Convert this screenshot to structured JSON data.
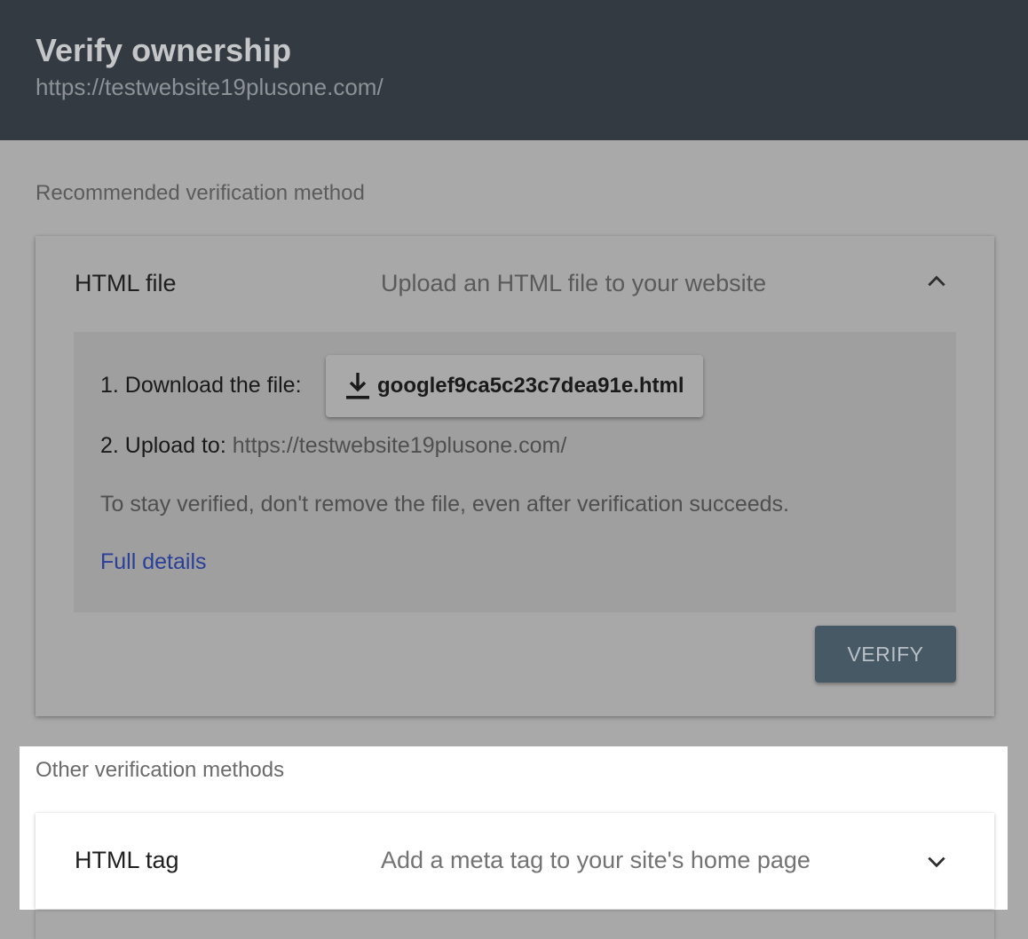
{
  "header": {
    "title": "Verify ownership",
    "url": "https://testwebsite19plusone.com/"
  },
  "recommended": {
    "section_label": "Recommended verification method",
    "method_name": "HTML file",
    "method_desc": "Upload an HTML file to your website",
    "expanded": true,
    "step1_label": "1. Download the file:",
    "download_file": "googlef9ca5c23c7dea91e.html",
    "step2_label": "2. Upload to:",
    "step2_url": "https://testwebsite19plusone.com/",
    "note": "To stay verified, don't remove the file, even after verification succeeds.",
    "link": "Full details",
    "verify_label": "VERIFY"
  },
  "other": {
    "section_label": "Other verification methods",
    "methods": [
      {
        "name": "HTML tag",
        "desc": "Add a meta tag to your site's home page",
        "expanded": false
      }
    ]
  },
  "colors": {
    "header_bg": "#333a41",
    "verify_button_bg": "#485966",
    "link": "#2a3f9a",
    "overlay_bg": "#a9a9a9"
  },
  "icons": {
    "download": "download-icon",
    "collapse": "chevron-up-icon",
    "expand": "chevron-down-icon"
  }
}
